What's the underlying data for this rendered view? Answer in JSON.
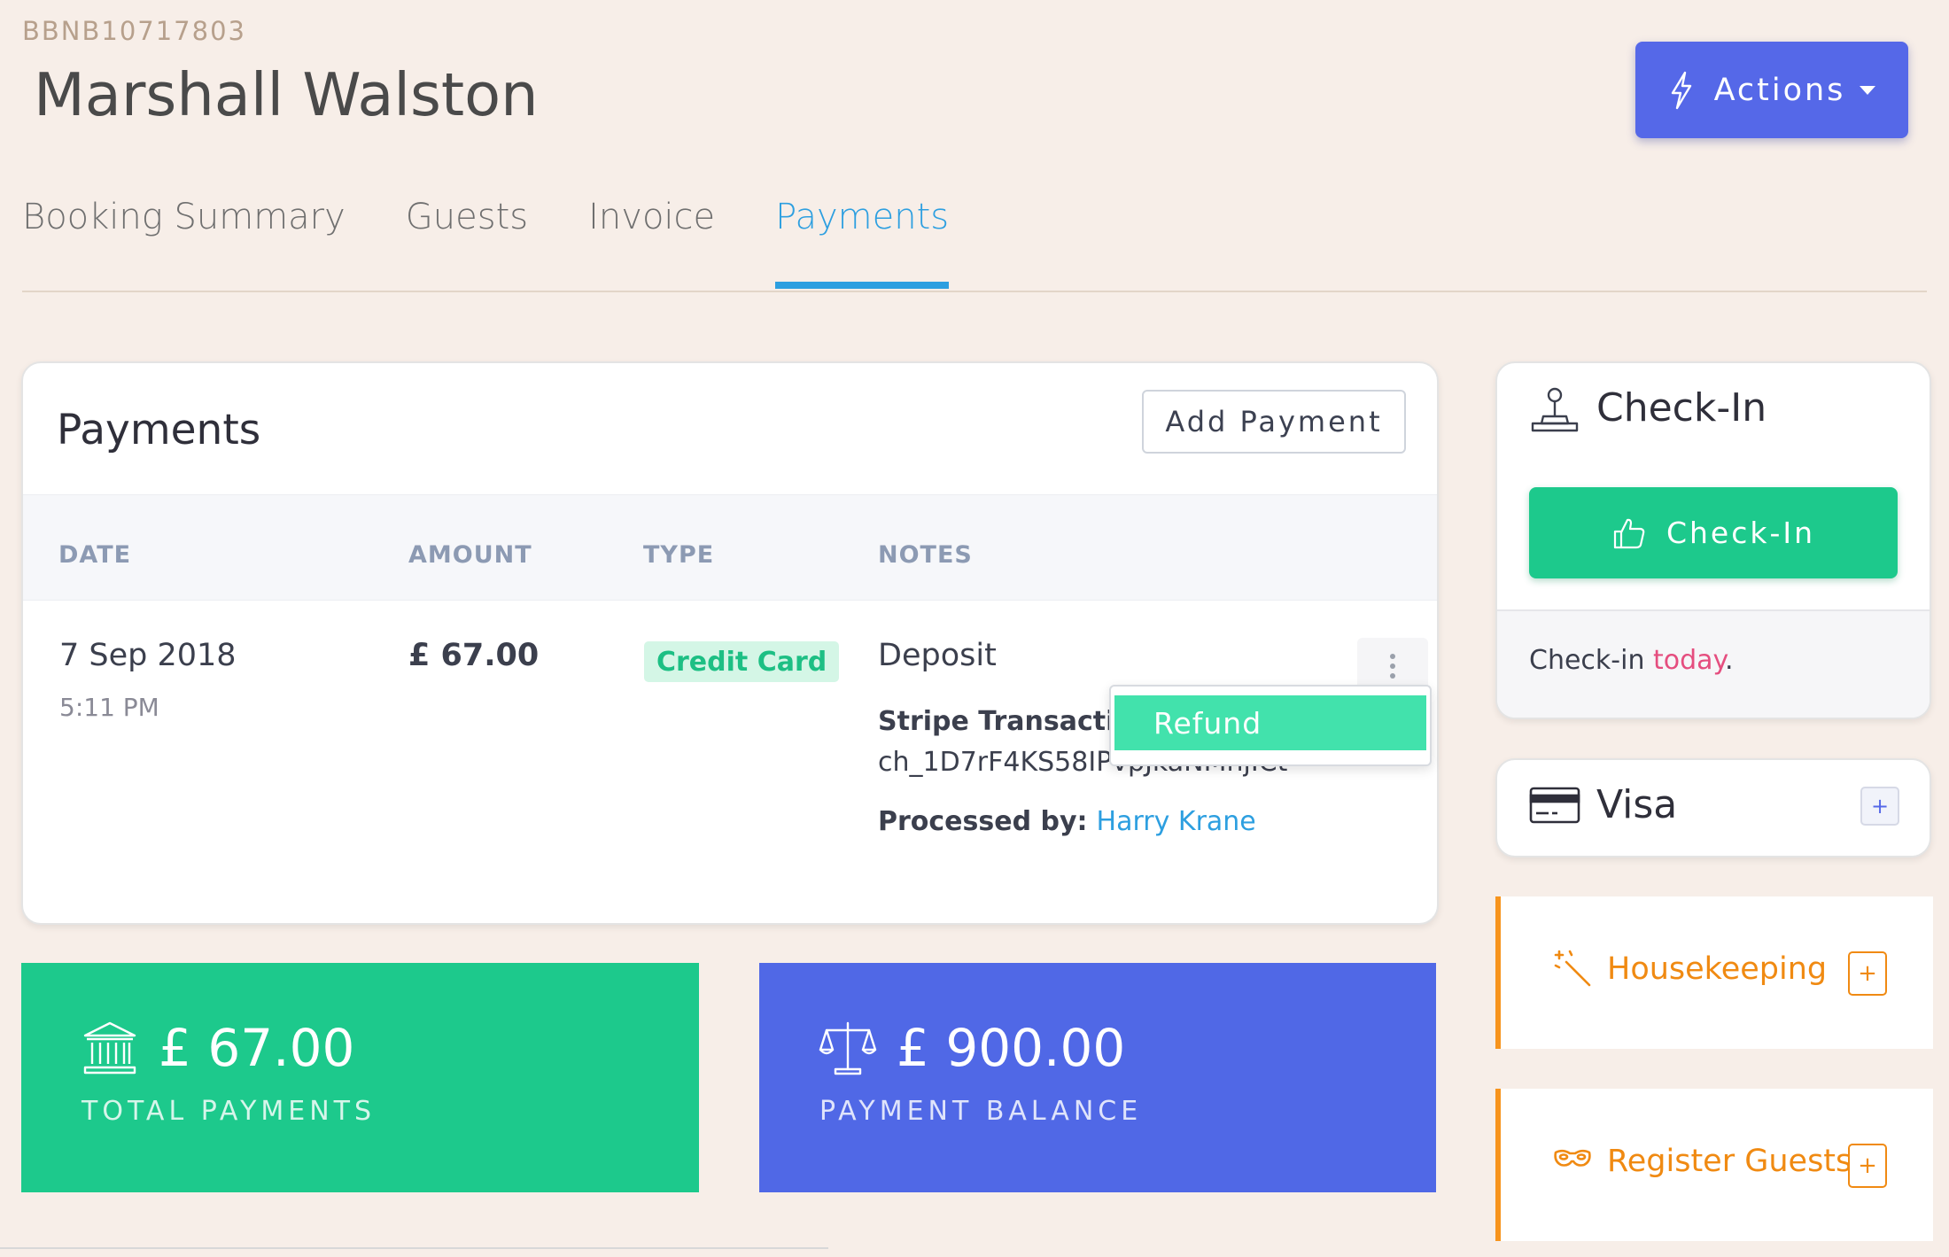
{
  "header": {
    "booking_ref": "BBNB10717803",
    "guest_name": "Marshall Walston",
    "actions_label": "Actions"
  },
  "tabs": [
    {
      "label": "Booking Summary"
    },
    {
      "label": "Guests"
    },
    {
      "label": "Invoice"
    },
    {
      "label": "Payments",
      "active": true
    }
  ],
  "payments": {
    "title": "Payments",
    "add_label": "Add Payment",
    "columns": [
      "DATE",
      "AMOUNT",
      "TYPE",
      "NOTES"
    ],
    "rows": [
      {
        "date": "7 Sep 2018",
        "time": "5:11 PM",
        "amount": "£ 67.00",
        "type": "Credit Card",
        "note": "Deposit",
        "stripe_label": "Stripe Transaction",
        "stripe_id": "ch_1D7rF4KS58IPvpJkaNMnjICt",
        "processed_label": "Processed by:",
        "processed_by": "Harry Krane"
      }
    ],
    "row_menu": {
      "refund_label": "Refund"
    }
  },
  "totals": {
    "total_payments": {
      "value": "£ 67.00",
      "label": "TOTAL PAYMENTS"
    },
    "payment_balance": {
      "value": "£ 900.00",
      "label": "PAYMENT BALANCE"
    }
  },
  "checkin": {
    "title": "Check-In",
    "button_label": "Check-In",
    "status_prefix": "Check-in ",
    "status_when": "today",
    "status_suffix": "."
  },
  "card": {
    "title": "Visa",
    "add": "+"
  },
  "tasks": [
    {
      "label": "Housekeeping",
      "add": "+"
    },
    {
      "label": "Register Guests",
      "add": "+"
    }
  ],
  "colors": {
    "background": "#f7eee8",
    "actions": "#5568e8",
    "active_tab": "#2d9fe0",
    "success": "#1dc98c",
    "balance": "#5068e6",
    "refund": "#42e2ac",
    "task_accent": "#f7941d",
    "today_text": "#e54e7f"
  },
  "icons": {
    "actions": "lightning-icon",
    "total": "bank-icon",
    "balance": "scales-icon",
    "checkin_header": "joystick-icon",
    "checkin_button": "thumbs-up-icon",
    "card": "credit-card-icon",
    "housekeeping": "magic-wand-icon",
    "register": "mask-icon"
  }
}
